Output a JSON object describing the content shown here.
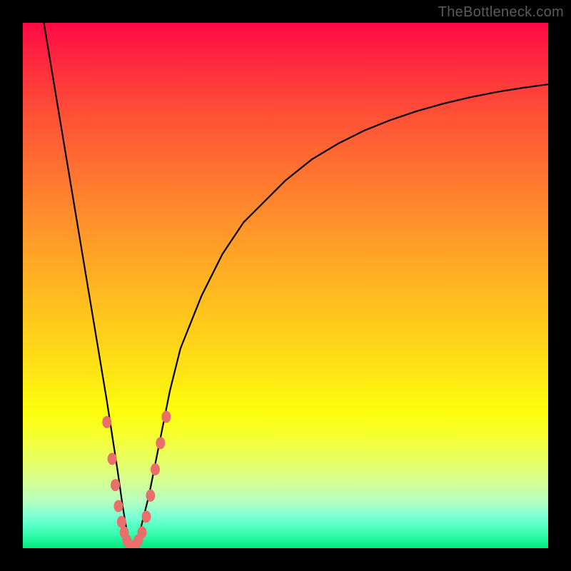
{
  "watermark": "TheBottleneck.com",
  "chart_data": {
    "type": "line",
    "title": "",
    "xlabel": "",
    "ylabel": "",
    "xlim": [
      0,
      100
    ],
    "ylim": [
      0,
      100
    ],
    "grid": false,
    "background": "red-to-green vertical gradient (red top, green bottom)",
    "series": [
      {
        "name": "bottleneck-curve",
        "color": "#000000",
        "x": [
          4,
          6,
          8,
          10,
          12,
          14,
          16,
          18,
          19,
          20,
          21,
          22,
          24,
          26,
          28,
          30,
          34,
          38,
          42,
          46,
          50,
          55,
          60,
          65,
          70,
          75,
          80,
          85,
          90,
          95,
          100
        ],
        "y": [
          100,
          88,
          76,
          64,
          52,
          40,
          28,
          15,
          8,
          2,
          0,
          2,
          10,
          20,
          30,
          38,
          48,
          56,
          62,
          66,
          70,
          74,
          77,
          79.5,
          81.5,
          83.2,
          84.6,
          85.8,
          86.8,
          87.6,
          88.3
        ]
      }
    ],
    "markers": [
      {
        "name": "left-dots",
        "color": "#e86f6a",
        "points": [
          {
            "x": 16.0,
            "y": 24
          },
          {
            "x": 17.0,
            "y": 17
          },
          {
            "x": 17.6,
            "y": 12
          },
          {
            "x": 18.2,
            "y": 8
          },
          {
            "x": 18.8,
            "y": 5
          },
          {
            "x": 19.3,
            "y": 3
          },
          {
            "x": 19.8,
            "y": 1.5
          },
          {
            "x": 20.3,
            "y": 0.5
          }
        ]
      },
      {
        "name": "bottom-dots",
        "color": "#e86f6a",
        "points": [
          {
            "x": 20.8,
            "y": 0
          },
          {
            "x": 21.4,
            "y": 0.5
          },
          {
            "x": 22.0,
            "y": 1.5
          },
          {
            "x": 22.7,
            "y": 3
          }
        ]
      },
      {
        "name": "right-dots",
        "color": "#e86f6a",
        "points": [
          {
            "x": 23.5,
            "y": 6
          },
          {
            "x": 24.3,
            "y": 10
          },
          {
            "x": 25.2,
            "y": 15
          },
          {
            "x": 26.2,
            "y": 20
          },
          {
            "x": 27.3,
            "y": 25
          }
        ]
      }
    ]
  }
}
